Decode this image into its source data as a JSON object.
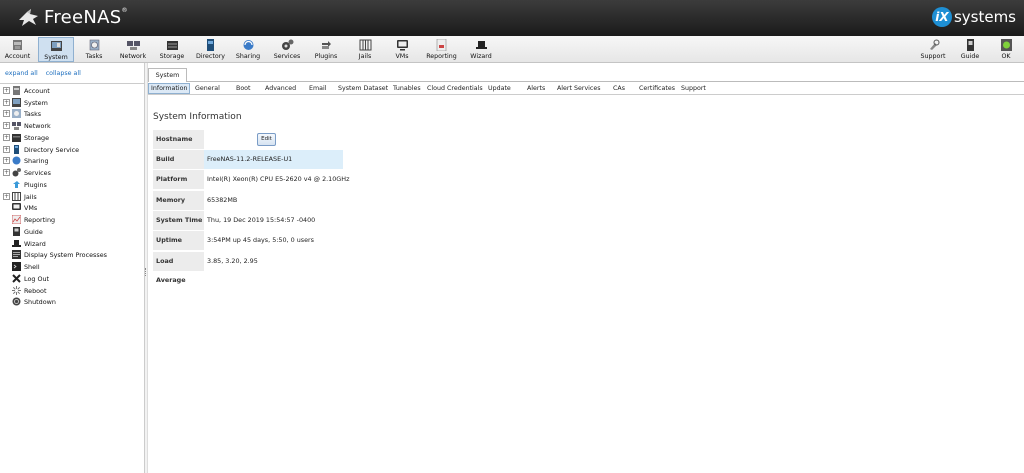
{
  "header": {
    "brand": "FreeNAS",
    "brand_mark": "®",
    "vendor_prefix": "iX",
    "vendor_suffix": "systems"
  },
  "toolbar": {
    "left": [
      {
        "label": "Account",
        "icon": "account-icon"
      },
      {
        "label": "System",
        "icon": "system-icon",
        "active": true
      },
      {
        "label": "Tasks",
        "icon": "tasks-icon"
      },
      {
        "label": "Network",
        "icon": "network-icon"
      },
      {
        "label": "Storage",
        "icon": "storage-icon"
      },
      {
        "label": "Directory",
        "icon": "directory-icon"
      },
      {
        "label": "Sharing",
        "icon": "sharing-icon"
      },
      {
        "label": "Services",
        "icon": "services-icon"
      },
      {
        "label": "Plugins",
        "icon": "plugins-icon"
      },
      {
        "label": "Jails",
        "icon": "jails-icon"
      },
      {
        "label": "VMs",
        "icon": "vms-icon"
      },
      {
        "label": "Reporting",
        "icon": "reporting-icon"
      },
      {
        "label": "Wizard",
        "icon": "wizard-icon"
      }
    ],
    "right": [
      {
        "label": "Support",
        "icon": "support-icon"
      },
      {
        "label": "Guide",
        "icon": "guide-icon"
      },
      {
        "label": "OK",
        "icon": "ok-icon"
      }
    ]
  },
  "left_panel": {
    "expand_all": "expand all",
    "collapse_all": "collapse all",
    "tree": [
      {
        "label": "Account",
        "expandable": true
      },
      {
        "label": "System",
        "expandable": true
      },
      {
        "label": "Tasks",
        "expandable": true
      },
      {
        "label": "Network",
        "expandable": true
      },
      {
        "label": "Storage",
        "expandable": true
      },
      {
        "label": "Directory Service",
        "expandable": true
      },
      {
        "label": "Sharing",
        "expandable": true
      },
      {
        "label": "Services",
        "expandable": true
      },
      {
        "label": "Plugins",
        "expandable": false
      },
      {
        "label": "Jails",
        "expandable": true
      },
      {
        "label": "VMs",
        "expandable": false
      },
      {
        "label": "Reporting",
        "expandable": false
      },
      {
        "label": "Guide",
        "expandable": false
      },
      {
        "label": "Wizard",
        "expandable": false
      },
      {
        "label": "Display System Processes",
        "expandable": false
      },
      {
        "label": "Shell",
        "expandable": false
      },
      {
        "label": "Log Out",
        "expandable": false
      },
      {
        "label": "Reboot",
        "expandable": false
      },
      {
        "label": "Shutdown",
        "expandable": false
      }
    ]
  },
  "main": {
    "outer_tab": "System",
    "subtabs": [
      "Information",
      "General",
      "Boot",
      "Advanced",
      "Email",
      "System Dataset",
      "Tunables",
      "Cloud Credentials",
      "Update",
      "Alerts",
      "Alert Services",
      "CAs",
      "Certificates",
      "Support"
    ],
    "active_subtab": "Information",
    "section_title": "System Information",
    "edit_label": "Edit",
    "rows": [
      {
        "label": "Hostname",
        "value": ""
      },
      {
        "label": "Build",
        "value": "FreeNAS-11.2-RELEASE-U1"
      },
      {
        "label": "Platform",
        "value": "Intel(R) Xeon(R) CPU E5-2620 v4 @ 2.10GHz"
      },
      {
        "label": "Memory",
        "value": "65382MB"
      },
      {
        "label": "System Time",
        "value": "Thu, 19 Dec 2019 15:54:57 -0400"
      },
      {
        "label": "Uptime",
        "value": "3:54PM up 45 days, 5:50, 0 users"
      },
      {
        "label": "Load Average",
        "value": "3.85, 3.20, 2.95"
      }
    ]
  }
}
